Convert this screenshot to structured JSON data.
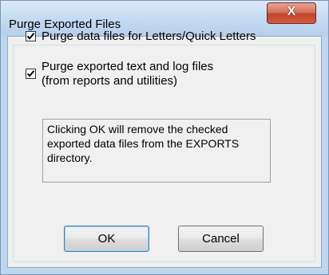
{
  "window": {
    "title": "Purge Exported Files",
    "close_glyph": "X"
  },
  "options": [
    {
      "label": "Purge data files for Letters/Quick Letters",
      "checked": true
    },
    {
      "label_line1": "Purge exported text and log files",
      "label_line2": "(from reports and utilities)",
      "checked": true
    }
  ],
  "info": {
    "text": "Clicking OK will remove the checked\nexported data files from the  EXPORTS\ndirectory."
  },
  "buttons": {
    "ok": "OK",
    "cancel": "Cancel"
  },
  "colors": {
    "titlebar": "#c5dbf2",
    "close_button": "#c0432b",
    "client": "#f0f0f0"
  }
}
